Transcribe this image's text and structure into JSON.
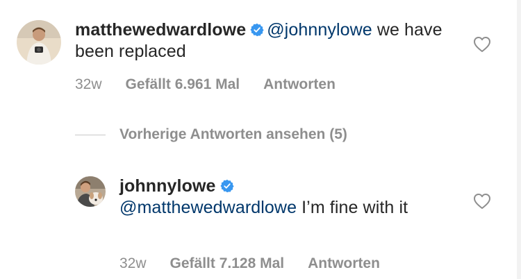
{
  "comments": [
    {
      "username": "matthewedwardlowe",
      "mention": "@johnnylowe",
      "text": " we have been replaced",
      "time": "32w",
      "likes": "Gefällt 6.961 Mal",
      "reply_label": "Antworten"
    },
    {
      "username": "johnnylowe",
      "mention": "@matthewedwardlowe",
      "text": " I’m fine with it",
      "time": "32w",
      "likes": "Gefällt 7.128 Mal",
      "reply_label": "Antworten"
    }
  ],
  "view_replies_label": "Vorherige Antworten ansehen (5)",
  "icons": {
    "verified": "verified-badge-icon",
    "like": "heart-outline-icon"
  },
  "colors": {
    "text": "#262626",
    "mention": "#00376b",
    "meta": "#8e8e8e",
    "verified": "#3897f0"
  }
}
